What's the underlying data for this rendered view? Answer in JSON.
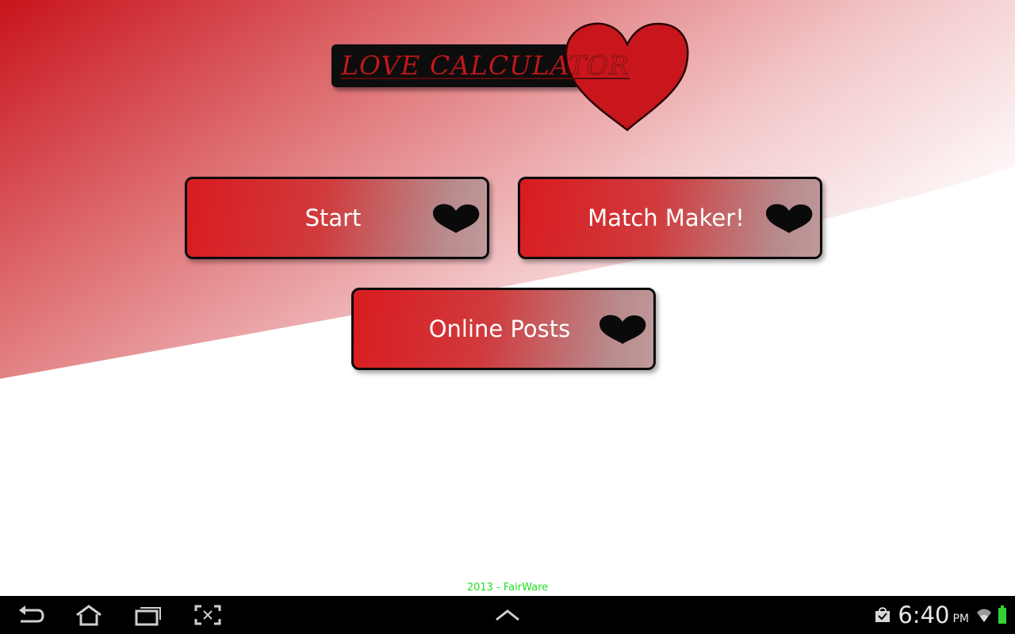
{
  "app": {
    "title": "LOVE CALCULATOR",
    "colors": {
      "accent": "#d91b20",
      "heart": "#c8161c",
      "footer_text": "#22dd22"
    }
  },
  "menu": {
    "buttons": [
      {
        "id": "start",
        "label": "Start",
        "icon": "heart-icon"
      },
      {
        "id": "match_maker",
        "label": "Match Maker!",
        "icon": "heart-icon"
      },
      {
        "id": "online_posts",
        "label": "Online Posts",
        "icon": "heart-icon"
      }
    ]
  },
  "footer": {
    "credit": "2013 - FairWare"
  },
  "navbar": {
    "icons": [
      "back-icon",
      "home-icon",
      "recent-apps-icon",
      "screenshot-icon",
      "chevron-up-icon"
    ]
  },
  "status": {
    "time": "6:40",
    "ampm": "PM",
    "icons": [
      "shopping-bag-icon",
      "wifi-icon",
      "battery-icon"
    ]
  }
}
